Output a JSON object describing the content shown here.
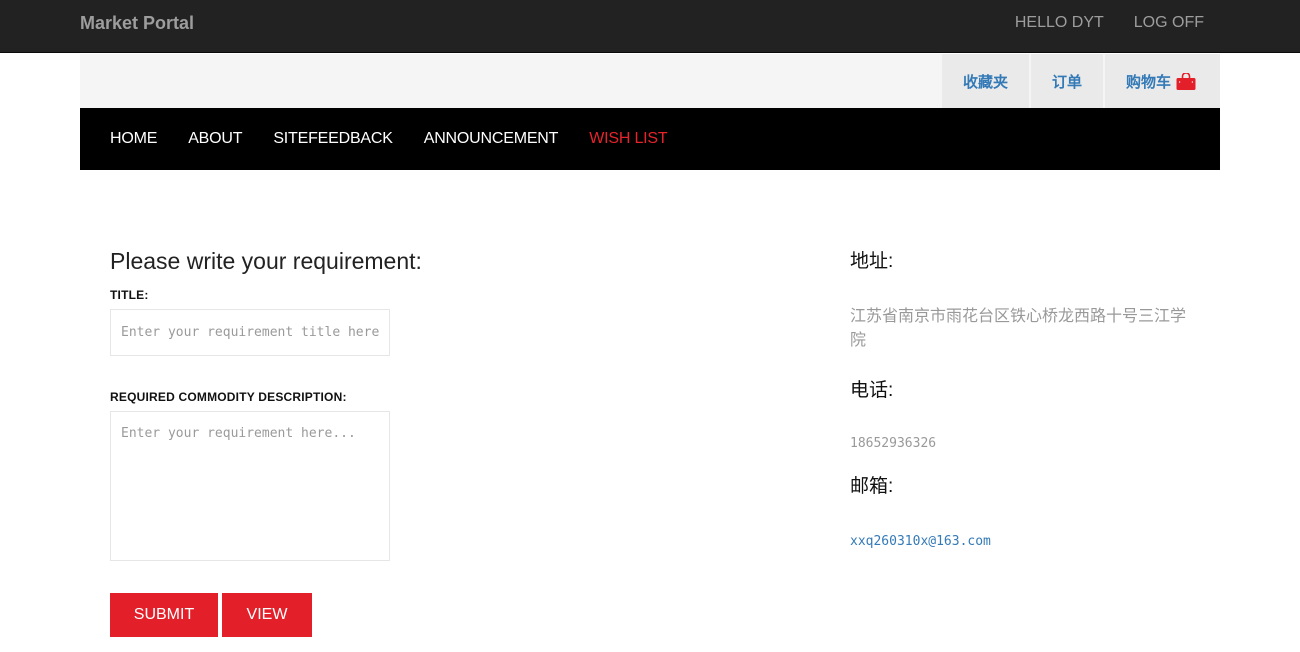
{
  "brand": "Market Portal",
  "user_nav": {
    "greeting": "HELLO DYT",
    "logout": "LOG OFF"
  },
  "utility_links": {
    "favorites": "收藏夹",
    "orders": "订单",
    "cart": "购物车"
  },
  "main_nav": [
    "HOME",
    "ABOUT",
    "SITEFEEDBACK",
    "ANNOUNCEMENT",
    "WISH LIST"
  ],
  "active_nav": "WISH LIST",
  "colors": {
    "accent": "#e3202a",
    "link": "#337ab7",
    "topbar": "#222222",
    "nav": "#000000"
  },
  "form": {
    "heading": "Please write your requirement:",
    "title_label": "TITLE:",
    "title_placeholder": "Enter your requirement title here...",
    "desc_label": "REQUIRED COMMODITY DESCRIPTION:",
    "desc_placeholder": "Enter your requirement here...",
    "submit": "SUBMIT",
    "view": "VIEW"
  },
  "contact": {
    "address_label": "地址:",
    "address": "江苏省南京市雨花台区铁心桥龙西路十号三江学院",
    "phone_label": "电话:",
    "phone": "18652936326",
    "email_label": "邮箱:",
    "email": "xxq260310x@163.com"
  },
  "icons": {
    "cart": "shopping-bag-icon"
  }
}
